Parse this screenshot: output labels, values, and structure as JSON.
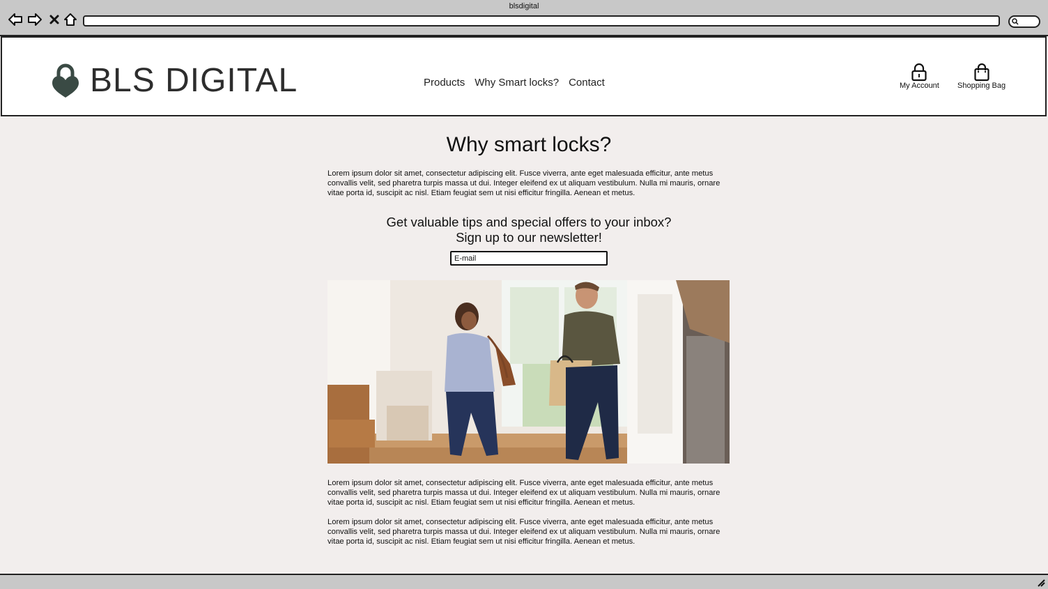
{
  "window": {
    "title": "blsdigital"
  },
  "browser": {
    "back_icon": "arrow-left-icon",
    "forward_icon": "arrow-right-icon",
    "close_icon": "x-icon",
    "home_icon": "home-icon",
    "url": "",
    "search_icon": "search-icon"
  },
  "header": {
    "logo_text": "BLS DIGITAL",
    "nav": [
      "Products",
      "Why Smart locks?",
      "Contact"
    ],
    "my_account": "My Account",
    "shopping_bag": "Shopping Bag"
  },
  "main": {
    "title": "Why smart locks?",
    "intro": "Lorem ipsum dolor sit amet, consectetur adipiscing elit. Fusce viverra, ante eget malesuada efficitur, ante metus convallis velit, sed pharetra turpis massa ut dui. Integer eleifend ex ut aliquam vestibulum. Nulla mi mauris, ornare vitae porta id, suscipit ac nisl. Etiam feugiat sem ut nisi efficitur fringilla. Aenean et metus.",
    "newsletter_line1": "Get valuable tips and special offers to your inbox?",
    "newsletter_line2": "Sign up to our newsletter!",
    "email_placeholder": "E-mail",
    "para2": "Lorem ipsum dolor sit amet, consectetur adipiscing elit. Fusce viverra, ante eget malesuada efficitur, ante metus convallis velit, sed pharetra turpis massa ut dui. Integer eleifend ex ut aliquam vestibulum. Nulla mi mauris, ornare vitae porta id, suscipit ac nisl. Etiam feugiat sem ut nisi efficitur fringilla. Aenean et metus.",
    "para3": "Lorem ipsum dolor sit amet, consectetur adipiscing elit. Fusce viverra, ante eget malesuada efficitur, ante metus convallis velit, sed pharetra turpis massa ut dui. Integer eleifend ex ut aliquam vestibulum. Nulla mi mauris, ornare vitae porta id, suscipit ac nisl. Etiam feugiat sem ut nisi efficitur fringilla. Aenean et metus."
  },
  "colors": {
    "page_bg": "#f2eeed",
    "logo": "#3a4a44",
    "chrome": "#c8c8c8"
  }
}
